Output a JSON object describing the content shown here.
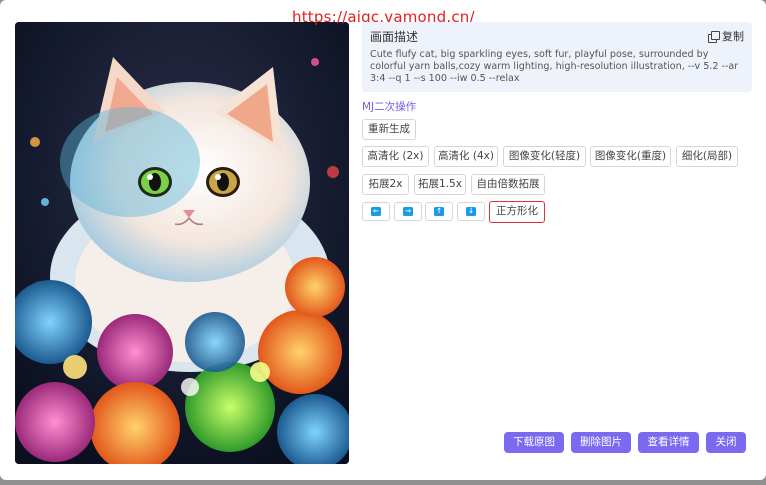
{
  "watermark": "https://aigc.vamond.cn/",
  "description": {
    "title": "画面描述",
    "copy_label": "复制",
    "text": "Cute flufy cat, big sparkling eyes, soft fur, playful pose, surrounded by colorful yarn balls,cozy warm lighting, high-resolution illustration, --v 5.2 --ar 3:4 --q 1 --s 100 --iw 0.5 --relax"
  },
  "mj": {
    "section_label": "MJ二次操作",
    "regenerate": "重新生成",
    "row1": [
      "高清化 (2x)",
      "高清化 (4x)",
      "图像变化(轻度)",
      "图像变化(重度)",
      "细化(局部)"
    ],
    "row2": [
      "拓展2x",
      "拓展1.5x",
      "自由倍数拓展"
    ],
    "arrows": [
      {
        "icon": "arrow-left-icon",
        "glyph": "←"
      },
      {
        "icon": "arrow-right-icon",
        "glyph": "→"
      },
      {
        "icon": "arrow-up-icon",
        "glyph": "↑"
      },
      {
        "icon": "arrow-down-icon",
        "glyph": "↓"
      }
    ],
    "square": "正方形化"
  },
  "actions": {
    "download": "下载原图",
    "delete": "删除图片",
    "details": "查看详情",
    "close": "关闭"
  },
  "colors": {
    "accent": "#7b69f0",
    "arrow_blue": "#1a9be6",
    "watermark_red": "#e02020",
    "highlight_border": "#d33333"
  }
}
